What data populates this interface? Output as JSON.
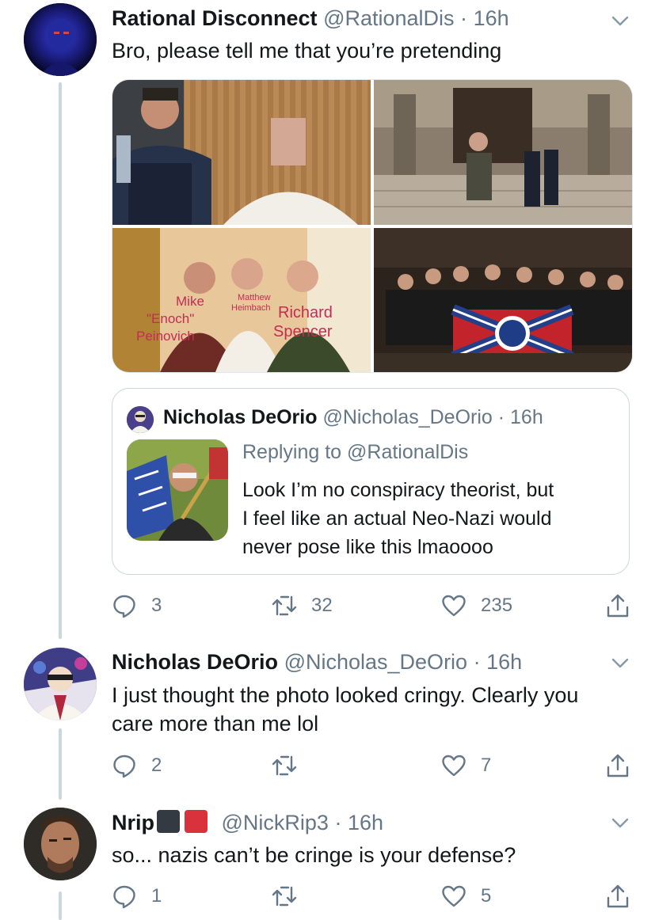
{
  "tweets": [
    {
      "name": "Rational Disconnect",
      "handle": "@RationalDis",
      "separator": "·",
      "time": "16h",
      "text": "Bro, please tell me that you’re pretending",
      "media_labels": {
        "mike": [
          "Mike",
          "\"Enoch\"",
          "Peinovich"
        ],
        "matthew": [
          "Matthew",
          "Heimbach"
        ],
        "richard": [
          "Richard",
          "Spencer"
        ]
      },
      "quote": {
        "name": "Nicholas DeOrio",
        "handle": "@Nicholas_DeOrio",
        "separator": "·",
        "time": "16h",
        "replying": "Replying to @RationalDis",
        "lines": [
          "Look I’m no conspiracy theorist, but",
          "I feel like an actual Neo-Nazi would",
          "never pose like this lmaoooo"
        ]
      },
      "replies": "3",
      "retweets": "32",
      "likes": "235"
    },
    {
      "name": "Nicholas DeOrio",
      "handle": "@Nicholas_DeOrio",
      "separator": "·",
      "time": "16h",
      "lines": [
        "I just thought the photo looked cringy. Clearly you",
        "care more than me lol"
      ],
      "replies": "2",
      "retweets": "",
      "likes": "7"
    },
    {
      "name": "Nrip",
      "flag_colors": [
        "#333a41",
        "#d9323c"
      ],
      "handle": "@NickRip3",
      "separator": "·",
      "time": "16h",
      "text": "so... nazis can’t be cringe is your defense?",
      "replies": "1",
      "retweets": "",
      "likes": "5"
    }
  ],
  "colors": {
    "text": "#14171a",
    "secondary": "#657786",
    "thread_line": "#ccd6dd",
    "border": "#ccd6dd"
  }
}
